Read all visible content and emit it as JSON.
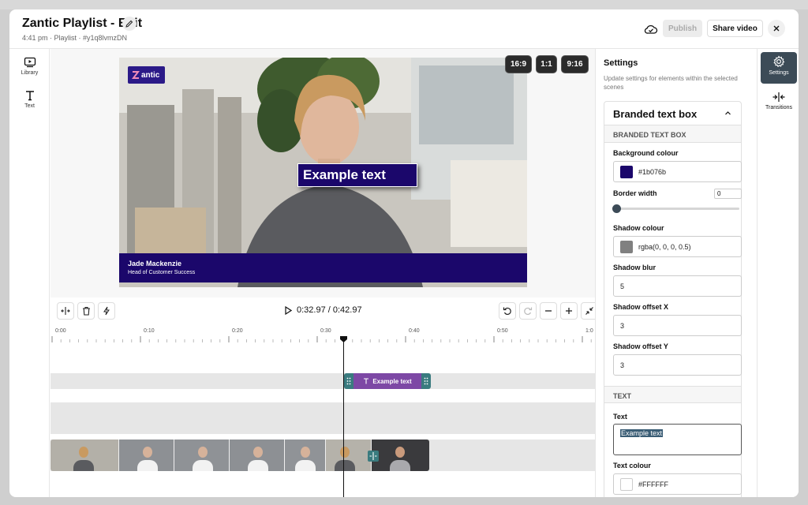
{
  "header": {
    "title": "Zantic Playlist - Edit",
    "subtitle": "4:41 pm · Playlist · #y1q8lvmzDN",
    "publish_label": "Publish",
    "share_label": "Share video"
  },
  "left_rail": {
    "items": [
      {
        "label": "Library",
        "icon": "library-icon"
      },
      {
        "label": "Text",
        "icon": "text-icon"
      }
    ]
  },
  "preview": {
    "logo_text": "antic",
    "text_box": "Example text",
    "lower_third": {
      "name": "Jade Mackenzie",
      "role": "Head of Customer Success"
    },
    "aspect_ratios": [
      "16:9",
      "1:1",
      "9:16"
    ]
  },
  "player": {
    "time": "0:32.97 / 0:42.97"
  },
  "timeline": {
    "tick_labels": [
      "0:00",
      "0:10",
      "0:20",
      "0:30",
      "0:40",
      "0:50",
      "1:0"
    ],
    "text_clip_label": "Example text",
    "playhead_seconds": 32.97,
    "duration_seconds": 42.97
  },
  "settings": {
    "title": "Settings",
    "description": "Update settings for elements within the selected scenes",
    "section_title": "Branded text box",
    "group1_title": "BRANDED TEXT BOX",
    "background_colour_label": "Background colour",
    "background_colour_value": "#1b076b",
    "border_width_label": "Border width",
    "border_width_value": "0",
    "shadow_colour_label": "Shadow colour",
    "shadow_colour_value": "rgba(0, 0, 0, 0.5)",
    "shadow_blur_label": "Shadow blur",
    "shadow_blur_value": "5",
    "shadow_offset_x_label": "Shadow offset X",
    "shadow_offset_x_value": "3",
    "shadow_offset_y_label": "Shadow offset Y",
    "shadow_offset_y_value": "3",
    "group2_title": "TEXT",
    "text_label": "Text",
    "text_value": "Example text",
    "text_colour_label": "Text colour",
    "text_colour_value": "#FFFFFF"
  },
  "right_rail": {
    "items": [
      {
        "label": "Settings",
        "icon": "gear-icon",
        "active": true
      },
      {
        "label": "Transitions",
        "icon": "transitions-icon",
        "active": false
      }
    ]
  },
  "colors": {
    "brand": "#1b076b",
    "clip_teal": "#3a7b7f",
    "clip_purple": "#7d48a5",
    "rail_active": "#3c4b57"
  }
}
